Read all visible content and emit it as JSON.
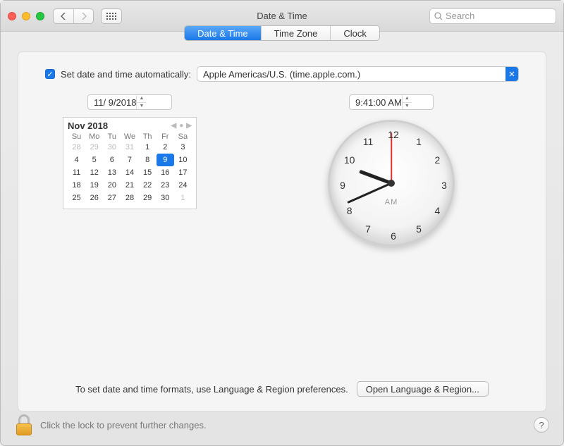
{
  "window": {
    "title": "Date & Time"
  },
  "search": {
    "placeholder": "Search"
  },
  "tabs": {
    "dateTime": "Date & Time",
    "timeZone": "Time Zone",
    "clock": "Clock"
  },
  "auto": {
    "label": "Set date and time automatically:",
    "server": "Apple Americas/U.S. (time.apple.com.)"
  },
  "date": {
    "value": "11/  9/2018"
  },
  "time": {
    "value": "9:41:00 AM"
  },
  "calendar": {
    "month": "Nov 2018",
    "dow": [
      "Su",
      "Mo",
      "Tu",
      "We",
      "Th",
      "Fr",
      "Sa"
    ],
    "lead": [
      "28",
      "29",
      "30",
      "31"
    ],
    "days": [
      "1",
      "2",
      "3",
      "4",
      "5",
      "6",
      "7",
      "8",
      "9",
      "10",
      "11",
      "12",
      "13",
      "14",
      "15",
      "16",
      "17",
      "18",
      "19",
      "20",
      "21",
      "22",
      "23",
      "24",
      "25",
      "26",
      "27",
      "28",
      "29",
      "30"
    ],
    "trail": [
      "1"
    ],
    "selected": "9"
  },
  "clockFace": {
    "ampm": "AM",
    "numbers": [
      "12",
      "1",
      "2",
      "3",
      "4",
      "5",
      "6",
      "7",
      "8",
      "9",
      "10",
      "11"
    ]
  },
  "formats": {
    "text": "To set date and time formats, use Language & Region preferences.",
    "button": "Open Language & Region..."
  },
  "lock": {
    "text": "Click the lock to prevent further changes."
  },
  "help": {
    "label": "?"
  }
}
